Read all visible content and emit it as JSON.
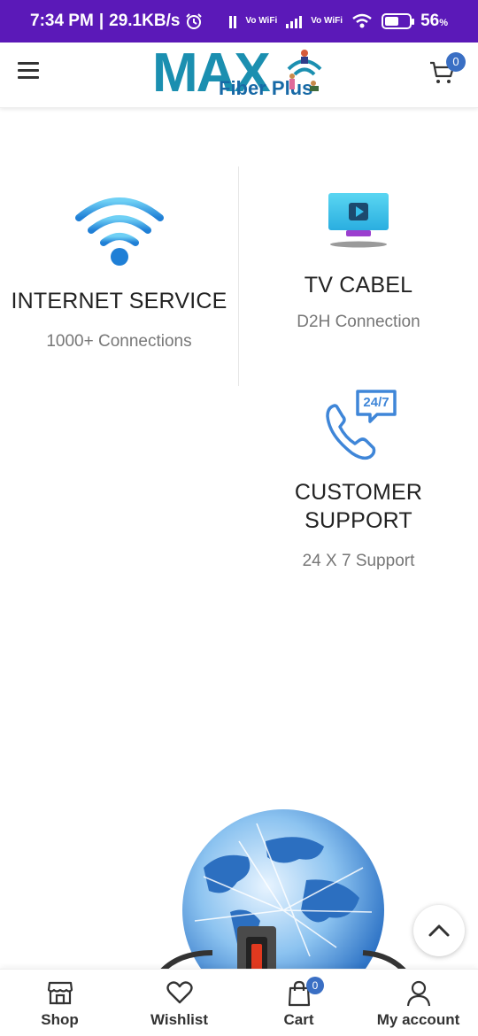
{
  "status_bar": {
    "time": "7:34 PM",
    "speed": "29.1KB/s",
    "vo_wifi_1": "Vo WiFi",
    "vo_wifi_2": "Vo WiFi",
    "battery_percent": "56",
    "battery_unit": "%",
    "battery_level": 0.56
  },
  "header": {
    "logo_main": "MAX",
    "logo_sub": "Fiber Plus",
    "cart_count": "0"
  },
  "features": [
    {
      "title": "INTERNET SERVICE",
      "subtitle": "1000+ Connections",
      "icon": "wifi-icon"
    },
    {
      "title": "TV CABEL",
      "subtitle": "D2H Connection",
      "icon": "tv-icon"
    },
    {
      "title_line1": "CUSTOMER",
      "title_line2": "SUPPORT",
      "subtitle": "24 X 7 Support",
      "icon": "phone-24-7-icon",
      "badge": "24/7"
    }
  ],
  "bottom_nav": {
    "items": [
      {
        "label": "Shop",
        "icon": "store-icon"
      },
      {
        "label": "Wishlist",
        "icon": "heart-icon"
      },
      {
        "label": "Cart",
        "icon": "bag-icon",
        "badge": "0"
      },
      {
        "label": "My account",
        "icon": "user-icon"
      }
    ]
  },
  "colors": {
    "status_bar": "#5b19b8",
    "brand_teal": "#1b8fb0",
    "brand_blue": "#1769a6",
    "badge_blue": "#3a6fc4",
    "wifi_blue": "#2d9be0"
  }
}
